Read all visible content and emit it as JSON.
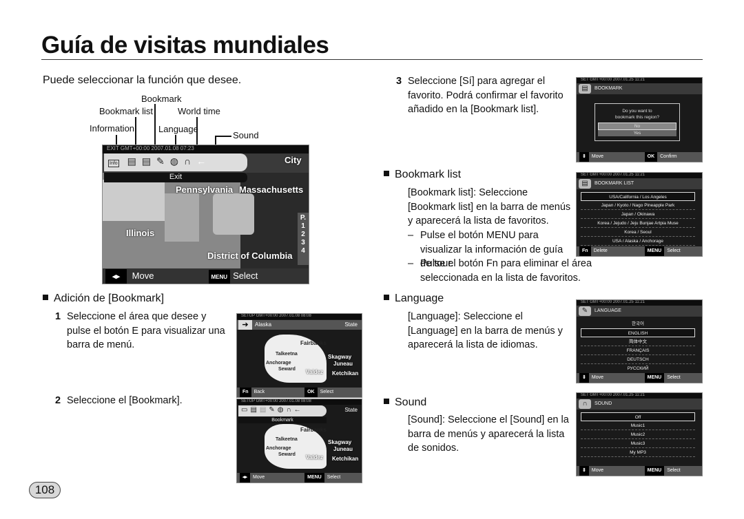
{
  "title": "Guía de visitas mundiales",
  "intro": "Puede seleccionar la función que desee.",
  "labels": {
    "bookmark": "Bookmark",
    "bookmark_list": "Bookmark list",
    "world_time": "World time",
    "information": "Information",
    "language": "Language",
    "sound": "Sound"
  },
  "main_screen": {
    "status": "EXIT   GMT+00:00 2007.01.08 07:23",
    "city_tab": "City",
    "exit": "Exit",
    "info_icon": "Info",
    "cities": [
      "Pennsylvania",
      "Massachusetts",
      "Illinois",
      "District of Columbia"
    ],
    "pages": "P. 1 2 3 4",
    "footer_move": "Move",
    "footer_menu_key": "MENU",
    "footer_select": "Select"
  },
  "section_add": {
    "heading": "Adición de [Bookmark]",
    "step1_num": "1",
    "step1": "Seleccione el área que desee y pulse el botón E para visualizar una barra de menú.",
    "step2_num": "2",
    "step2": "Seleccione el [Bookmark]."
  },
  "alaska1": {
    "status": "SETUP   GMT+00:00 2007.01.08 08:08",
    "header": "Alaska",
    "tab": "State",
    "cities": [
      "Fairbanks",
      "Talkeetna",
      "Anchorage",
      "Seward",
      "Valdez",
      "Skagway",
      "Juneau",
      "Ketchikan"
    ],
    "fn": "Fn",
    "back": "Back",
    "ok": "OK",
    "select": "Select"
  },
  "alaska2": {
    "status": "SETUP   GMT+00:00 2007.01.08 08:08",
    "tab": "State",
    "bar": "Bookmark",
    "cities": [
      "Fairbanks",
      "Talkeetna",
      "Anchorage",
      "Seward",
      "Valdez",
      "Skagway",
      "Juneau",
      "Ketchikan"
    ],
    "move": "Move",
    "menu": "MENU",
    "select": "Select"
  },
  "step3": {
    "num": "3",
    "text": "Seleccione [Sí] para agregar el favorito. Podrá confirmar el favorito añadido en la [Bookmark list]."
  },
  "bookmark_screen": {
    "status": "SET   GMT+00:00 2007.01.25 11:21",
    "header": "BOOKMARK",
    "question1": "Do you want to",
    "question2": "bookmark this region?",
    "no": "No",
    "yes": "Yes",
    "move": "Move",
    "ok": "OK",
    "confirm": "Confirm"
  },
  "bookmark_list": {
    "heading": "Bookmark list",
    "text": "[Bookmark list]: Seleccione [Bookmark list] en la barra de menús y aparecerá la lista de favoritos.",
    "bullet1": "Pulse el botón MENU para visualizar la información de guía de tour.",
    "bullet2": "Pulse el botón Fn para eliminar el área seleccionada en la lista de favoritos."
  },
  "bookmark_list_screen": {
    "status": "SET   GMT+00:00 2007.01.25 11:21",
    "header": "BOOKMARK LIST",
    "items": [
      "USA/California / Los Angeles",
      "Japan / Kyoto / Nago Pineapple Park",
      "Japan / Okinawa",
      "Korea / Jejudo / Jeju Bunjae Artpia Muse",
      "Korea / Seoul",
      "USA / Alaska / Anchorage"
    ],
    "fn": "Fn",
    "delete": "Delete",
    "menu": "MENU",
    "select": "Select"
  },
  "language": {
    "heading": "Language",
    "text": "[Language]: Seleccione el [Language] en la barra de menús y aparecerá la lista de idiomas."
  },
  "language_screen": {
    "status": "SET   GMT+00:00 2007.01.25 11:21",
    "header": "LANGUAGE",
    "items": [
      "한국어",
      "ENGLISH",
      "简体中文",
      "FRANÇAIS",
      "DEUTSCH",
      "РУССКИЙ"
    ],
    "move": "Move",
    "menu": "MENU",
    "select": "Select"
  },
  "sound": {
    "heading": "Sound",
    "text": "[Sound]: Seleccione el [Sound] en la barra de menús y aparecerá la lista de sonidos."
  },
  "sound_screen": {
    "status": "SET   GMT+00:00 2007.01.25 11:21",
    "header": "SOUND",
    "items": [
      "Off",
      "Music1",
      "Music2",
      "Music3",
      "My MP3"
    ],
    "move": "Move",
    "menu": "MENU",
    "select": "Select"
  },
  "page_number": "108"
}
